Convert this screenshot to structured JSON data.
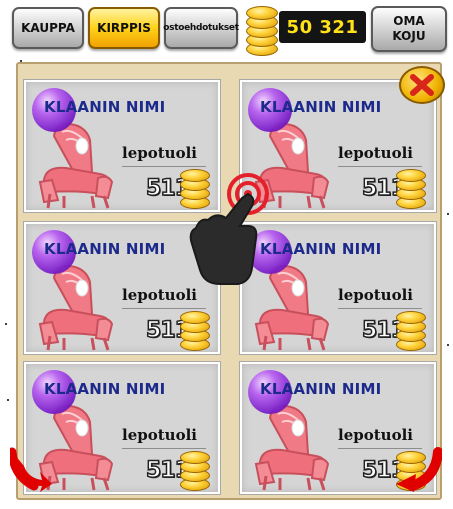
{
  "topbar": {
    "kauppa_label": "KAUPPA",
    "kirppis_label": "KIRPPIS",
    "ostoehdotukset_label": "ostoehdotukset",
    "coins_value": "50 321",
    "oma_koju_line1": "OMA",
    "oma_koju_line2": "KOJU"
  },
  "listings": [
    {
      "clan": "KLAANIN NIMI",
      "item": "lepotuoli",
      "price": "511"
    },
    {
      "clan": "KLAANIN NIMI",
      "item": "lepotuoli",
      "price": "511"
    },
    {
      "clan": "KLAANIN NIMI",
      "item": "lepotuoli",
      "price": "511"
    },
    {
      "clan": "KLAANIN NIMI",
      "item": "lepotuoli",
      "price": "511"
    },
    {
      "clan": "KLAANIN NIMI",
      "item": "lepotuoli",
      "price": "511"
    },
    {
      "clan": "KLAANIN NIMI",
      "item": "lepotuoli",
      "price": "511"
    }
  ],
  "icons": {
    "close": "close-icon",
    "coin": "coin-stack-icon",
    "tap_hint": "tap-hand-icon",
    "prev": "arrow-left-icon",
    "next": "arrow-right-icon"
  },
  "colors": {
    "accent_yellow": "#ffd21a",
    "clan_text": "#1c2a8c",
    "panel_bg": "#e8d9b3",
    "card_bg": "#d5d5d5",
    "arrow_red": "#e00000"
  }
}
